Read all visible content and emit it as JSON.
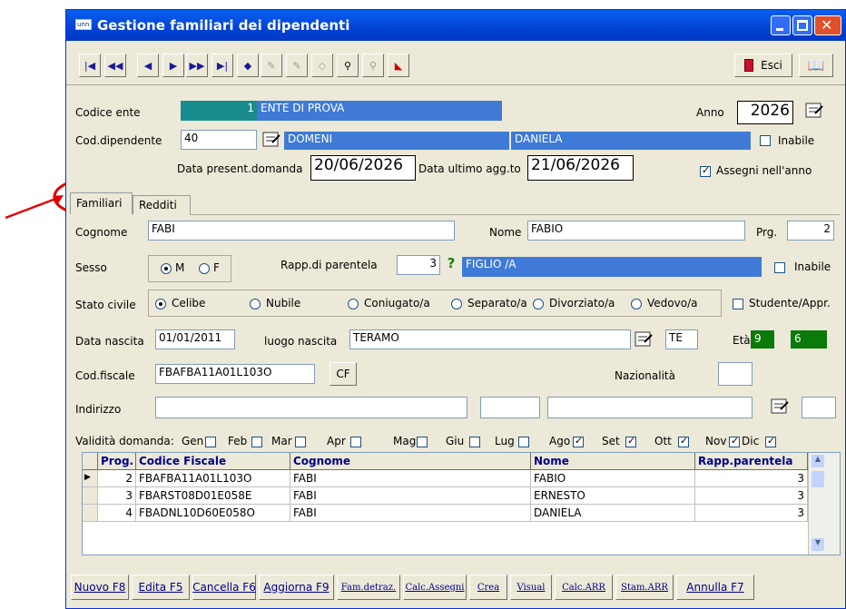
{
  "window": {
    "title": "Gestione familiari dei dipendenti",
    "icon_text": "unn",
    "exit_label": "Esci"
  },
  "toolbar": {
    "icons": [
      "first-icon",
      "prev-page-icon",
      "prev-icon",
      "next-icon",
      "next-page-icon",
      "last-icon",
      "new-record-icon",
      "edit-icon",
      "edit-alt-icon",
      "delete-icon",
      "search-icon",
      "search-alt-icon",
      "clear-icon"
    ]
  },
  "header": {
    "codice_ente_label": "Codice ente",
    "codice_ente_value": "1",
    "ente_name": "ENTE DI PROVA",
    "anno_label": "Anno",
    "anno_value": "2026",
    "cod_dip_label": "Cod.dipendente",
    "cod_dip_value": "40",
    "dip_cognome": "DOMENI",
    "dip_nome": "DANIELA",
    "inabile_label": "Inabile",
    "data_pres_label": "Data present.domanda",
    "data_pres_value": "20/06/2026",
    "data_agg_label": "Data ultimo agg.to",
    "data_agg_value": "21/06/2026",
    "assegni_label": "Assegni nell'anno",
    "assegni_checked": true
  },
  "tabs": [
    {
      "label": "Familiari",
      "active": true
    },
    {
      "label": "Redditi",
      "active": false
    }
  ],
  "form": {
    "cognome_label": "Cognome",
    "cognome_value": "FABI",
    "nome_label": "Nome",
    "nome_value": "FABIO",
    "prg_label": "Prg.",
    "prg_value": "2",
    "sesso_label": "Sesso",
    "sesso_m": "M",
    "sesso_f": "F",
    "rapp_label": "Rapp.di parentela",
    "rapp_value": "3",
    "rapp_help": "?",
    "rapp_desc": "FIGLIO /A",
    "inabile_label": "Inabile",
    "stato_label": "Stato civile",
    "stato_options": [
      "Celibe",
      "Nubile",
      "Coniugato/a",
      "Separato/a",
      "Divorziato/a",
      "Vedovo/a"
    ],
    "studente_label": "Studente/Appr.",
    "nascita_label": "Data nascita",
    "nascita_value": "01/01/2011",
    "luogo_label": "luogo nascita",
    "luogo_value": "TERAMO",
    "prov_value": "TE",
    "eta_label": "Età",
    "eta_a": "9",
    "eta_b": "6",
    "cf_label": "Cod.fiscale",
    "cf_value": "FBAFBA11A01L103O",
    "cf_button": "CF",
    "naz_label": "Nazionalità",
    "indirizzo_label": "Indirizzo",
    "validita_label": "Validità domanda:",
    "months": [
      {
        "m": "Gen",
        "on": false
      },
      {
        "m": "Feb",
        "on": false
      },
      {
        "m": "Mar",
        "on": false
      },
      {
        "m": "Apr",
        "on": false
      },
      {
        "m": "Mag",
        "on": false
      },
      {
        "m": "Giu",
        "on": false
      },
      {
        "m": "Lug",
        "on": false
      },
      {
        "m": "Ago",
        "on": true
      },
      {
        "m": "Set",
        "on": true
      },
      {
        "m": "Ott",
        "on": true
      },
      {
        "m": "Nov",
        "on": true
      },
      {
        "m": "Dic",
        "on": true
      }
    ]
  },
  "grid": {
    "columns": [
      "Prog.",
      "Codice Fiscale",
      "Cognome",
      "Nome",
      "Rapp.parentela"
    ],
    "rows": [
      [
        "2",
        "FBAFBA11A01L103O",
        "FABI",
        "FABIO",
        "3"
      ],
      [
        "3",
        "FBARST08D01E058E",
        "FABI",
        "ERNESTO",
        "3"
      ],
      [
        "4",
        "FBADNL10D60E058O",
        "FABI",
        "DANIELA",
        "3"
      ]
    ]
  },
  "footer": [
    "Nuovo F8",
    "Edita F5",
    "Cancella F6",
    "Aggiorna F9",
    "Fam.detraz.",
    "Calc.Assegni",
    "Crea",
    "Visual",
    "Calc.ARR",
    "Stam.ARR",
    "Annulla F7"
  ]
}
